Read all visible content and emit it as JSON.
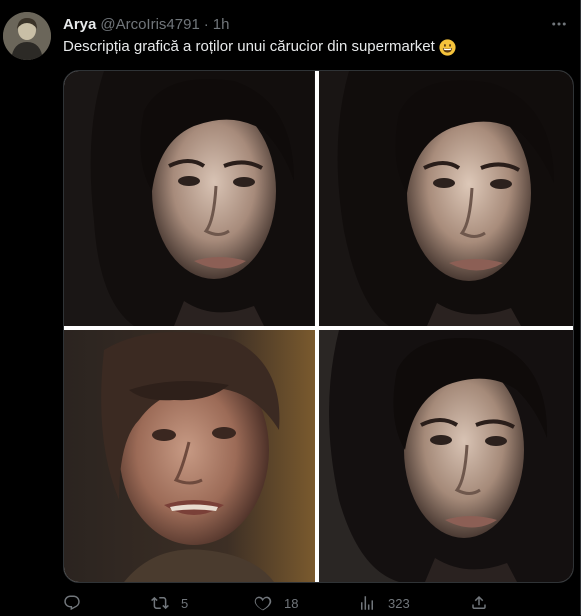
{
  "tweet": {
    "author_name": "Arya",
    "author_handle": "@ArcoIris4791",
    "separator": "·",
    "time": "1h",
    "text": "Descripția grafică a roților unui cărucior din supermarket",
    "emoji": "grinning-face-emoji",
    "more_icon": "more-icon",
    "avatar_icon": "avatar"
  },
  "media": {
    "panels": [
      "woman-portrait",
      "woman-portrait",
      "woman-smiling-bangs",
      "woman-portrait"
    ]
  },
  "actions": {
    "reply": {
      "icon": "reply-icon",
      "count": ""
    },
    "retweet": {
      "icon": "retweet-icon",
      "count": "5"
    },
    "like": {
      "icon": "heart-icon",
      "count": "18"
    },
    "views": {
      "icon": "views-icon",
      "count": "323"
    },
    "share": {
      "icon": "share-icon",
      "count": ""
    }
  },
  "colors": {
    "background": "#000000",
    "text": "#e7e9ea",
    "muted": "#71767b",
    "border": "#2f3336"
  }
}
